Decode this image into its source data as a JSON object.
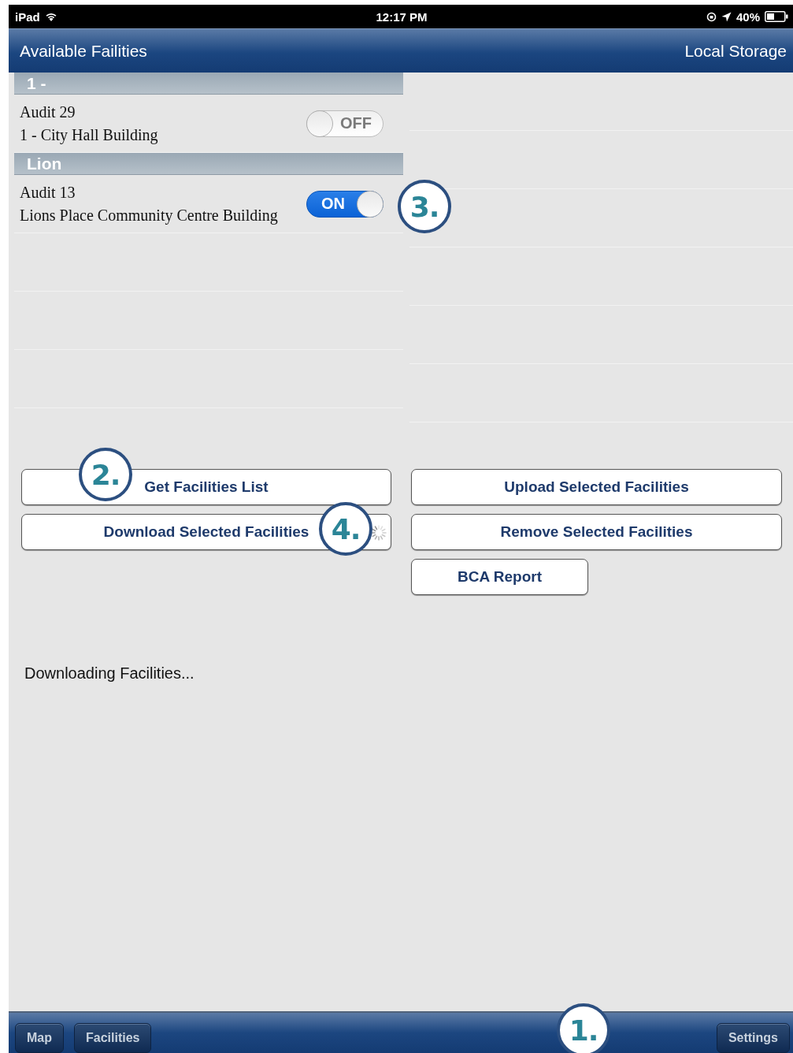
{
  "status_bar": {
    "device": "iPad",
    "time": "12:17 PM",
    "battery": "40%"
  },
  "nav_bar": {
    "title": "Available Failities",
    "right_title": "Local Storage"
  },
  "sections": [
    {
      "title": "1 -",
      "items": [
        {
          "title": "Audit 29",
          "subtitle": "1 - City Hall Building",
          "on": false,
          "toggle_label": "OFF"
        }
      ]
    },
    {
      "title": "Lion",
      "items": [
        {
          "title": "Audit 13",
          "subtitle": "Lions Place Community Centre Building",
          "on": true,
          "toggle_label": "ON"
        }
      ]
    }
  ],
  "left_buttons": [
    {
      "label": "Get Facilities List",
      "busy": false
    },
    {
      "label": "Download Selected Facilities",
      "busy": true
    }
  ],
  "right_buttons": [
    {
      "label": "Upload Selected Facilities",
      "wide": true
    },
    {
      "label": "Remove Selected Facilities",
      "wide": true
    },
    {
      "label": "BCA Report",
      "wide": false
    }
  ],
  "status_message": "Downloading Facilities...",
  "tab_bar": {
    "left_items": [
      "Map",
      "Facilities"
    ],
    "right_items": [
      "Settings"
    ]
  },
  "callouts": [
    "1.",
    "2.",
    "3.",
    "4."
  ]
}
